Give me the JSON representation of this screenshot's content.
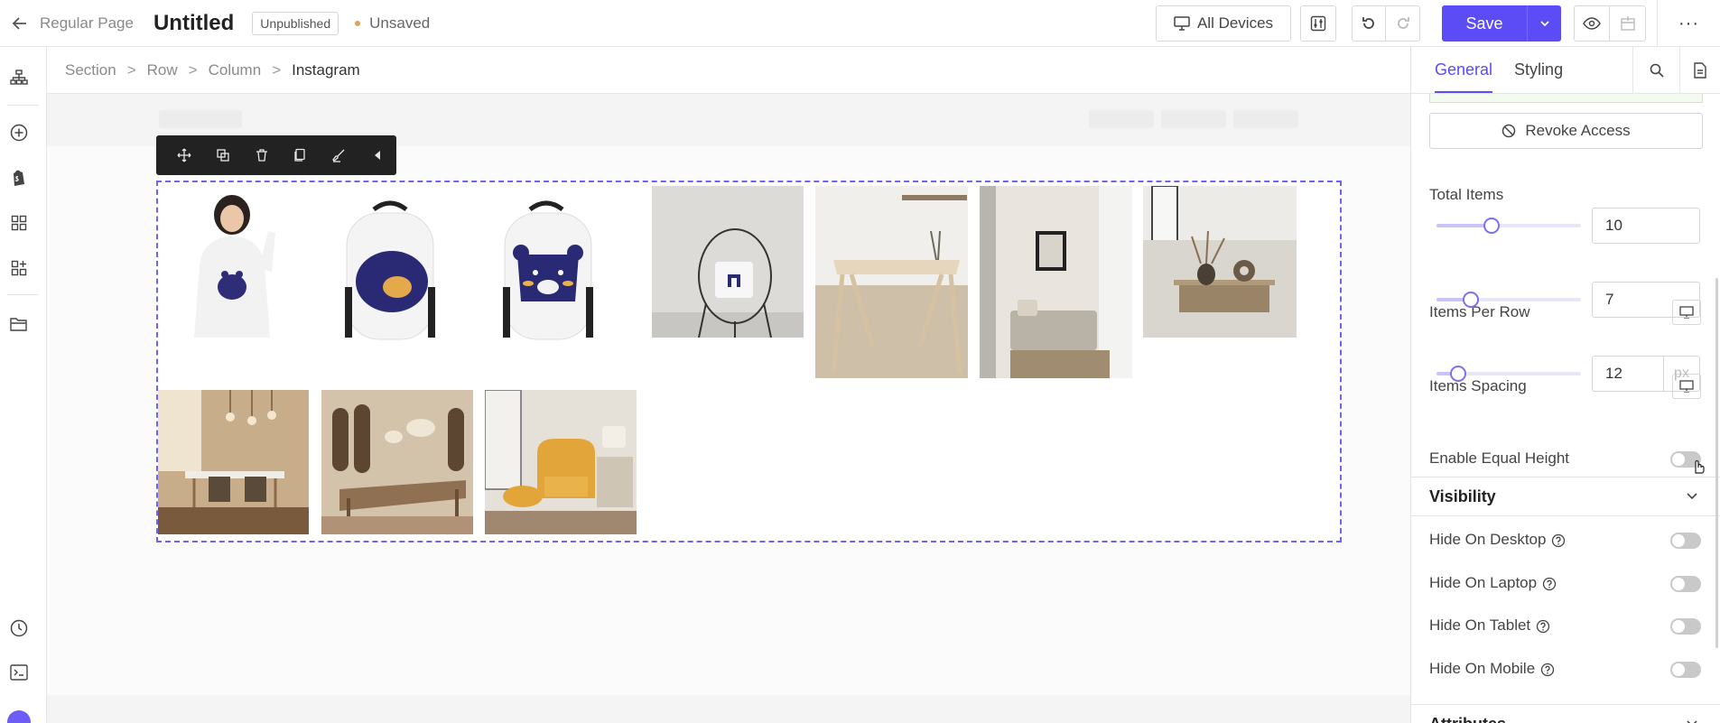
{
  "topbar": {
    "page_type": "Regular Page",
    "title": "Untitled",
    "status": "Unpublished",
    "save_state": "Unsaved",
    "devices_label": "All Devices",
    "save_label": "Save"
  },
  "breadcrumb": [
    "Section",
    "Row",
    "Column",
    "Instagram"
  ],
  "element_toolbar": [
    "move-icon",
    "duplicate-icon",
    "trash-icon",
    "copy-icon",
    "paint-brush-icon",
    "collapse-left-icon"
  ],
  "instagram": {
    "images": [
      "woman in white hoodie",
      "white backpack with sleeping bear",
      "white backpack with bear face",
      "pillow on wire chair",
      "wooden desk",
      "reading nook by window",
      "living room with coffee table",
      "dining room with pendant lamps",
      "long dining table",
      "yellow armchair with ottoman"
    ]
  },
  "panel": {
    "tabs": [
      "General",
      "Styling"
    ],
    "revoke_label": "Revoke Access",
    "total_items": {
      "label": "Total Items",
      "value": "10",
      "fill": 0.38
    },
    "items_per_row": {
      "label": "Items Per Row",
      "value": "7",
      "fill": 0.24
    },
    "items_spacing": {
      "label": "Items Spacing",
      "value": "12",
      "unit": "px",
      "fill": 0.15
    },
    "equal_height": {
      "label": "Enable Equal Height",
      "on": false
    },
    "visibility": {
      "title": "Visibility",
      "items": [
        {
          "label": "Hide On Desktop",
          "on": false
        },
        {
          "label": "Hide On Laptop",
          "on": false
        },
        {
          "label": "Hide On Tablet",
          "on": false
        },
        {
          "label": "Hide On Mobile",
          "on": false
        }
      ]
    },
    "attributes_title": "Attributes"
  },
  "colors": {
    "accent": "#5b4cf5",
    "dashed_border": "#6e63f3"
  }
}
